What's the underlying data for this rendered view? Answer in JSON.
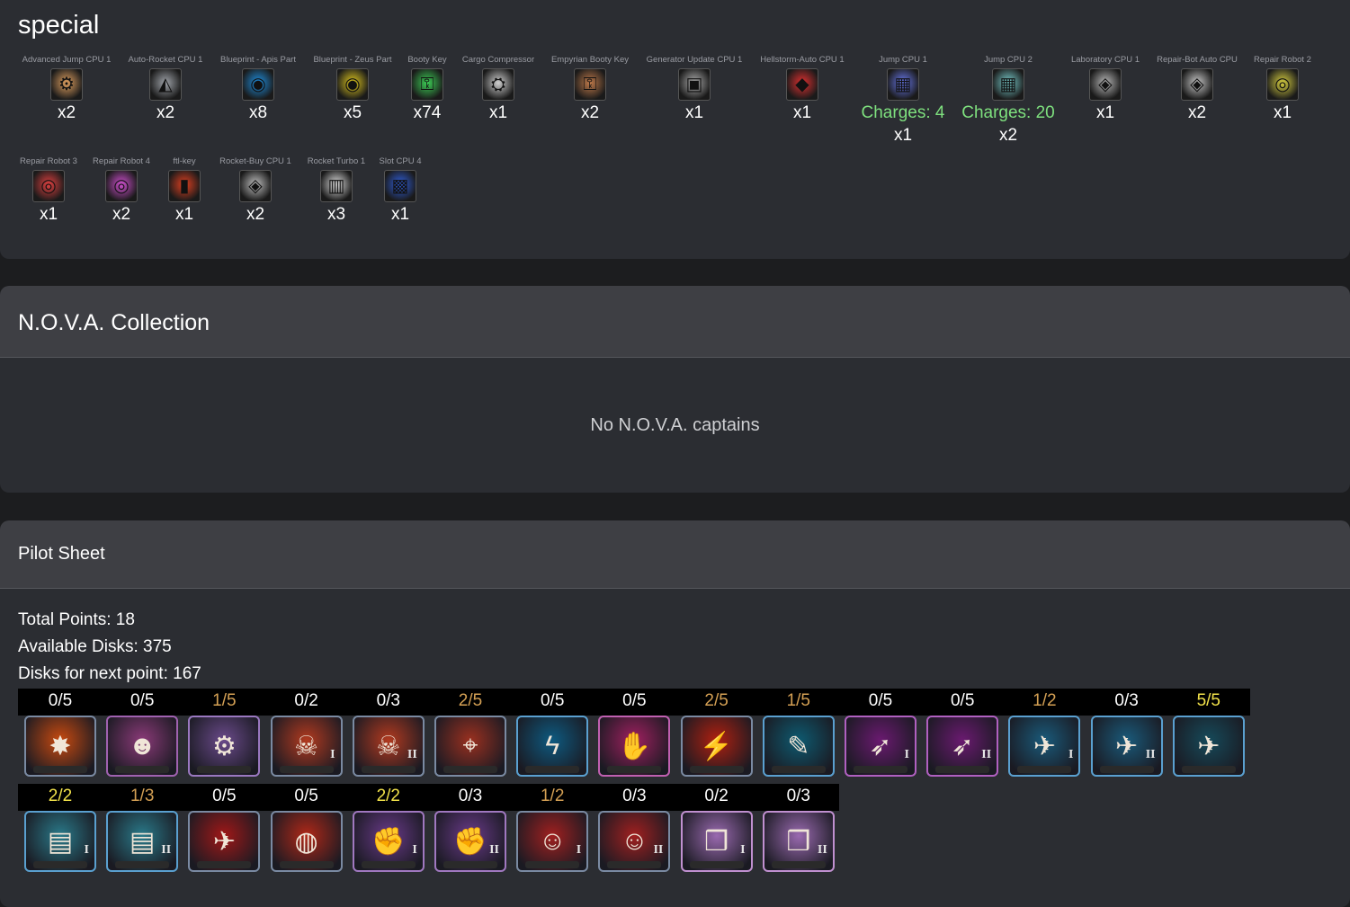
{
  "special": {
    "title": "special",
    "items": [
      {
        "name": "Advanced Jump CPU 1",
        "count": "x2",
        "icon": "gear-chip-icon",
        "glyph": "⚙",
        "color": "#e0a060"
      },
      {
        "name": "Auto-Rocket CPU 1",
        "count": "x2",
        "icon": "triangle-chip-icon",
        "glyph": "◭",
        "color": "#a0a4aa"
      },
      {
        "name": "Blueprint - Apis Part",
        "count": "x8",
        "icon": "blueprint-apis-icon",
        "glyph": "◉",
        "color": "#1d8fe0"
      },
      {
        "name": "Blueprint - Zeus Part",
        "count": "x5",
        "icon": "blueprint-zeus-icon",
        "glyph": "◉",
        "color": "#e0c81d"
      },
      {
        "name": "Booty Key",
        "count": "x74",
        "icon": "booty-key-icon",
        "glyph": "⚿",
        "color": "#3ccf55"
      },
      {
        "name": "Cargo Compressor",
        "count": "x1",
        "icon": "cargo-compressor-icon",
        "glyph": "⛭",
        "color": "#d0d0d0"
      },
      {
        "name": "Empyrian Booty Key",
        "count": "x2",
        "icon": "empyrian-key-icon",
        "glyph": "⚿",
        "color": "#c07a4a"
      },
      {
        "name": "Generator Update CPU 1",
        "count": "x1",
        "icon": "generator-chip-icon",
        "glyph": "▣",
        "color": "#b0b0b0"
      },
      {
        "name": "Hellstorm-Auto CPU 1",
        "count": "x1",
        "icon": "hellstorm-chip-icon",
        "glyph": "◆",
        "color": "#e03030"
      },
      {
        "name": "Jump CPU 1",
        "count": "x1",
        "charges": "Charges: 4",
        "icon": "jump-chip-icon",
        "glyph": "▦",
        "color": "#6a7af0"
      },
      {
        "name": "Jump CPU 2",
        "count": "x2",
        "charges": "Charges: 20",
        "icon": "jump-chip-2-icon",
        "glyph": "▦",
        "color": "#7ad0d0"
      },
      {
        "name": "Laboratory CPU 1",
        "count": "x1",
        "icon": "laboratory-chip-icon",
        "glyph": "◈",
        "color": "#b8b8b8"
      },
      {
        "name": "Repair-Bot Auto CPU",
        "count": "x2",
        "icon": "repair-bot-chip-icon",
        "glyph": "◈",
        "color": "#c8c8c8"
      },
      {
        "name": "Repair Robot 2",
        "count": "x1",
        "icon": "repair-robot-2-icon",
        "glyph": "◎",
        "color": "#d8d040"
      },
      {
        "name": "Repair Robot 3",
        "count": "x1",
        "icon": "repair-robot-3-icon",
        "glyph": "◎",
        "color": "#e04040"
      },
      {
        "name": "Repair Robot 4",
        "count": "x2",
        "icon": "repair-robot-4-icon",
        "glyph": "◎",
        "color": "#d050d0"
      },
      {
        "name": "ftl-key",
        "count": "x1",
        "icon": "ftl-key-icon",
        "glyph": "▮",
        "color": "#e04020"
      },
      {
        "name": "Rocket-Buy CPU 1",
        "count": "x2",
        "icon": "rocket-buy-chip-icon",
        "glyph": "◈",
        "color": "#c0c0c0"
      },
      {
        "name": "Rocket Turbo 1",
        "count": "x3",
        "icon": "rocket-turbo-icon",
        "glyph": "▥",
        "color": "#e0e0e0"
      },
      {
        "name": "Slot CPU 4",
        "count": "x1",
        "icon": "slot-chip-icon",
        "glyph": "▩",
        "color": "#3060e0"
      }
    ]
  },
  "nova": {
    "title": "N.O.V.A. Collection",
    "empty_message": "No N.O.V.A. captains"
  },
  "pilot": {
    "title": "Pilot Sheet",
    "total_points": "Total Points: 18",
    "available_disks": "Available Disks: 375",
    "disks_next": "Disks for next point: 167",
    "row1": [
      {
        "level": "0/5",
        "tier": "zero",
        "icon": "explosion-skill-icon",
        "glyph": "✸",
        "bg": "#c84a10",
        "border": "#7a8aa2"
      },
      {
        "level": "0/5",
        "tier": "zero",
        "icon": "commander-face-skill-icon",
        "glyph": "☻",
        "bg": "#8a3a78",
        "border": "#a062b0"
      },
      {
        "level": "1/5",
        "tier": "partial",
        "icon": "cargo-machine-skill-icon",
        "glyph": "⚙",
        "bg": "#6a4a8a",
        "border": "#9a78c0"
      },
      {
        "level": "0/2",
        "tier": "zero",
        "icon": "skull-skill-icon",
        "glyph": "☠",
        "bg": "#b23a20",
        "border": "#7a8aa2",
        "roman": "I"
      },
      {
        "level": "0/3",
        "tier": "zero",
        "icon": "skull-skill-2-icon",
        "glyph": "☠",
        "bg": "#b23a20",
        "border": "#7a8aa2",
        "roman": "II"
      },
      {
        "level": "2/5",
        "tier": "partial",
        "icon": "rifle-skill-icon",
        "glyph": "⌖",
        "bg": "#9a3020",
        "border": "#7a8aa2"
      },
      {
        "level": "0/5",
        "tier": "zero",
        "icon": "lightning-skill-icon",
        "glyph": "ϟ",
        "bg": "#0e5a80",
        "border": "#5aa0d0"
      },
      {
        "level": "0/5",
        "tier": "zero",
        "icon": "grab-hand-skill-icon",
        "glyph": "✋",
        "bg": "#a02060",
        "border": "#c060b0"
      },
      {
        "level": "2/5",
        "tier": "partial",
        "icon": "laser-beam-skill-icon",
        "glyph": "⚡",
        "bg": "#b02010",
        "border": "#7a8aa2"
      },
      {
        "level": "1/5",
        "tier": "partial",
        "icon": "wrench-skill-icon",
        "glyph": "✎",
        "bg": "#0e5a70",
        "border": "#5aa0d0"
      },
      {
        "level": "0/5",
        "tier": "zero",
        "icon": "rocket-trail-skill-icon",
        "glyph": "➶",
        "bg": "#6a1a70",
        "border": "#b060c0",
        "roman": "I"
      },
      {
        "level": "0/5",
        "tier": "zero",
        "icon": "rocket-trail-2-skill-icon",
        "glyph": "➶",
        "bg": "#6a1a70",
        "border": "#b060c0",
        "roman": "II"
      },
      {
        "level": "1/2",
        "tier": "partial",
        "icon": "ship-thrust-skill-icon",
        "glyph": "✈",
        "bg": "#1a5a7a",
        "border": "#5aa0d0",
        "roman": "I"
      },
      {
        "level": "0/3",
        "tier": "zero",
        "icon": "ship-thrust-2-skill-icon",
        "glyph": "✈",
        "bg": "#1a5a7a",
        "border": "#5aa0d0",
        "roman": "II"
      },
      {
        "level": "5/5",
        "tier": "max",
        "icon": "ship-radar-skill-icon",
        "glyph": "✈",
        "bg": "#164a5a",
        "border": "#5aa0d0"
      }
    ],
    "row2": [
      {
        "level": "2/2",
        "tier": "max",
        "icon": "credit-bills-skill-icon",
        "glyph": "▤",
        "bg": "#2a7a8a",
        "border": "#5aa0d0",
        "roman": "I"
      },
      {
        "level": "1/3",
        "tier": "partial",
        "icon": "credit-bills-2-skill-icon",
        "glyph": "▤",
        "bg": "#2a7a8a",
        "border": "#5aa0d0",
        "roman": "II"
      },
      {
        "level": "0/5",
        "tier": "zero",
        "icon": "fighter-ship-skill-icon",
        "glyph": "✈",
        "bg": "#a01818",
        "border": "#7a8aa2"
      },
      {
        "level": "0/5",
        "tier": "zero",
        "icon": "planet-ring-skill-icon",
        "glyph": "◍",
        "bg": "#b02818",
        "border": "#7a8aa2"
      },
      {
        "level": "2/2",
        "tier": "max",
        "icon": "fist-skill-icon",
        "glyph": "✊",
        "bg": "#6a3a8a",
        "border": "#a078c0",
        "roman": "I"
      },
      {
        "level": "0/3",
        "tier": "zero",
        "icon": "fist-2-skill-icon",
        "glyph": "✊",
        "bg": "#6a3a8a",
        "border": "#a078c0",
        "roman": "II"
      },
      {
        "level": "1/2",
        "tier": "partial",
        "icon": "pilot-face-skill-icon",
        "glyph": "☺",
        "bg": "#a02020",
        "border": "#7a8aa2",
        "roman": "I"
      },
      {
        "level": "0/3",
        "tier": "zero",
        "icon": "pilot-face-2-skill-icon",
        "glyph": "☺",
        "bg": "#a02020",
        "border": "#7a8aa2",
        "roman": "II"
      },
      {
        "level": "0/2",
        "tier": "zero",
        "icon": "cubes-skill-icon",
        "glyph": "❒",
        "bg": "#9a6ab0",
        "border": "#c090d0",
        "roman": "I"
      },
      {
        "level": "0/3",
        "tier": "zero",
        "icon": "cubes-2-skill-icon",
        "glyph": "❒",
        "bg": "#9a6ab0",
        "border": "#c090d0",
        "roman": "II"
      }
    ],
    "colors": {
      "zero": "#ffffff",
      "partial": "#d4a054",
      "max": "#f2e24a"
    }
  }
}
